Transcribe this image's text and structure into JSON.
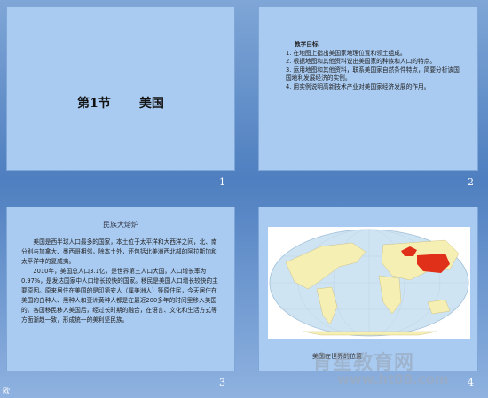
{
  "slides": [
    {
      "number": "1",
      "title_section": "第1节",
      "title_country": "美国"
    },
    {
      "number": "2",
      "heading": "教学目标",
      "items": [
        "1. 在地图上指出美国家地理位置和领土组成。",
        "2. 根据地图和其他资料说出美国家的种族和人口的特点。",
        "3. 运用地图和其他资料，联系美国家自然条件特点，简要分析该国国地利发展经济的实例。",
        "4. 用实例说明高新技术产业对美国家经济发展的作用。"
      ]
    },
    {
      "number": "3",
      "heading": "民族大熔炉",
      "paragraphs": [
        "美国是西半球人口最多的国家，本土位于太平洋和大西洋之间，北、南分别与加拿大、墨西哥相邻，除本土外，还包括北美洲西北部的阿拉斯加和太平洋中的夏威夷。",
        "2010年，美国总人口3.1亿，是世界第三人口大国，人口增长率为0.97%，是发达国家中人口增长较快的国家。移民是美国人口增长较快的主要原因。原来居住在美国的是印第安人（属美洲人）等原住民，今天居住在美国的白种人、黑种人和亚洲黄种人都是在最近200多年的时间里移入美国的。各国移民移入美国后，经过长时期的融合，在语言、文化和生活方式等方面渐趋一致，形成统一的美利坚民族。"
      ]
    },
    {
      "number": "4",
      "caption": "美国在世界的位置"
    }
  ],
  "watermark": {
    "line1": "育星教育网",
    "line2": "www.ht88.com"
  },
  "corner_text": "欧",
  "colors": {
    "slide_bg": "#a9cbf2",
    "us_red": "#e0301a",
    "land": "#f6efb4",
    "ocean": "#cfe4f3"
  }
}
